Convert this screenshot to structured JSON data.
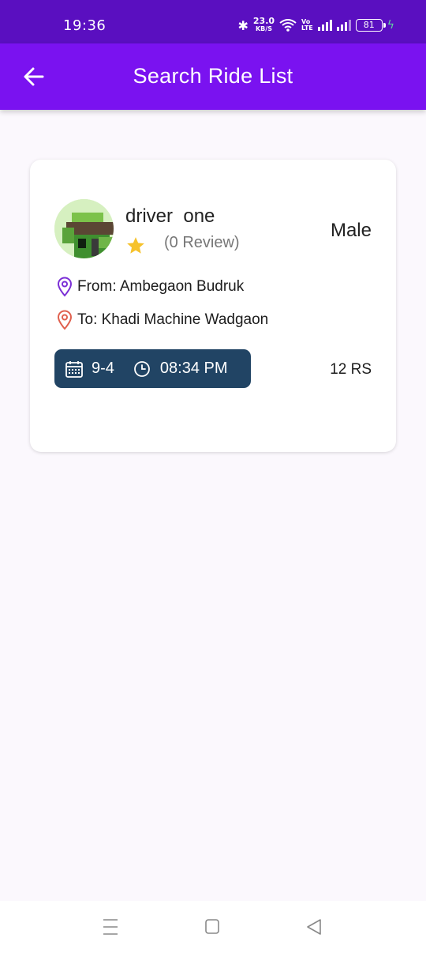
{
  "status_bar": {
    "time": "19:36",
    "net_speed": "23.0",
    "net_unit": "KB/S",
    "volte_top": "Vo",
    "volte_bottom": "LTE",
    "battery": "81"
  },
  "app_bar": {
    "title": "Search Ride List",
    "back_icon": "arrow-left-icon"
  },
  "ride": {
    "driver_name": "driver  one",
    "rating_icon": "star-icon",
    "reviews": "(0 Review)",
    "gender": "Male",
    "from": "From: Ambegaon Budruk",
    "to": "To: Khadi Machine Wadgaon",
    "date": "9-4",
    "time": "08:34 PM",
    "price": "12 RS"
  },
  "colors": {
    "status_bar": "#5a0fc0",
    "app_bar": "#7a12f0",
    "pill": "#214464",
    "star": "#f6c22c",
    "from_pin": "#7b2fd6",
    "to_pin": "#e0604e"
  },
  "nav_bar": {
    "recents_icon": "recents-icon",
    "home_icon": "home-icon",
    "back_icon": "back-triangle-icon"
  }
}
